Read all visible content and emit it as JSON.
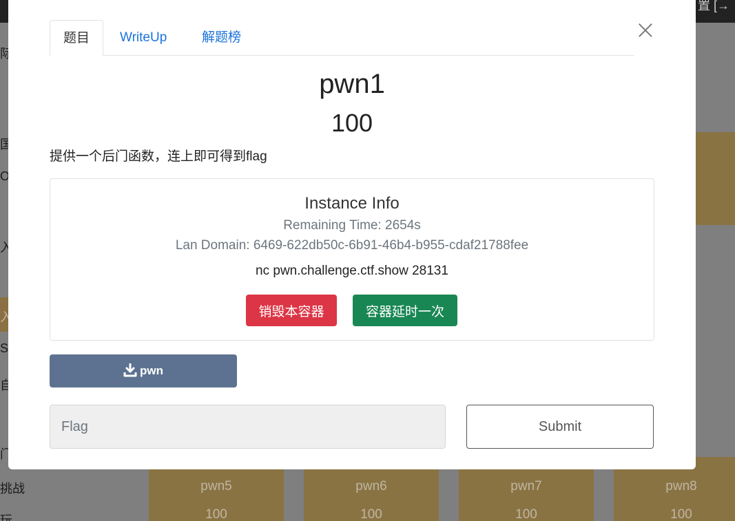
{
  "background": {
    "topbar_right": "置 [→",
    "sidebar_fragments": [
      "际",
      "国",
      "O",
      "入门",
      "入门",
      "SI",
      "自目",
      "门",
      "挑战",
      "玩"
    ],
    "cards": [
      {
        "name": "pwn5",
        "points": "100"
      },
      {
        "name": "pwn6",
        "points": "100"
      },
      {
        "name": "pwn7",
        "points": "100"
      },
      {
        "name": "pwn8",
        "points": "100"
      }
    ]
  },
  "modal": {
    "tabs": [
      {
        "label": "题目",
        "active": true
      },
      {
        "label": "WriteUp",
        "active": false
      },
      {
        "label": "解题榜",
        "active": false
      }
    ],
    "close_symbol": "×",
    "challenge": {
      "title": "pwn1",
      "points": "100",
      "description": "提供一个后门函数，连上即可得到flag"
    },
    "instance": {
      "title": "Instance Info",
      "remaining_time": "Remaining Time: 2654s",
      "lan_domain": "Lan Domain: 6469-622db50c-6b91-46b4-b955-cdaf21788fee",
      "nc_command": "nc pwn.challenge.ctf.show 28131",
      "destroy_label": "销毁本容器",
      "extend_label": "容器延时一次"
    },
    "download": {
      "label": "pwn",
      "icon": "download-icon"
    },
    "flag_form": {
      "placeholder": "Flag",
      "value": "",
      "submit_label": "Submit"
    }
  },
  "colors": {
    "tab_link": "#1a73d9",
    "danger": "#dc3545",
    "success": "#198754",
    "download_btn": "#5d7290",
    "card_bg": "#8a7343"
  }
}
